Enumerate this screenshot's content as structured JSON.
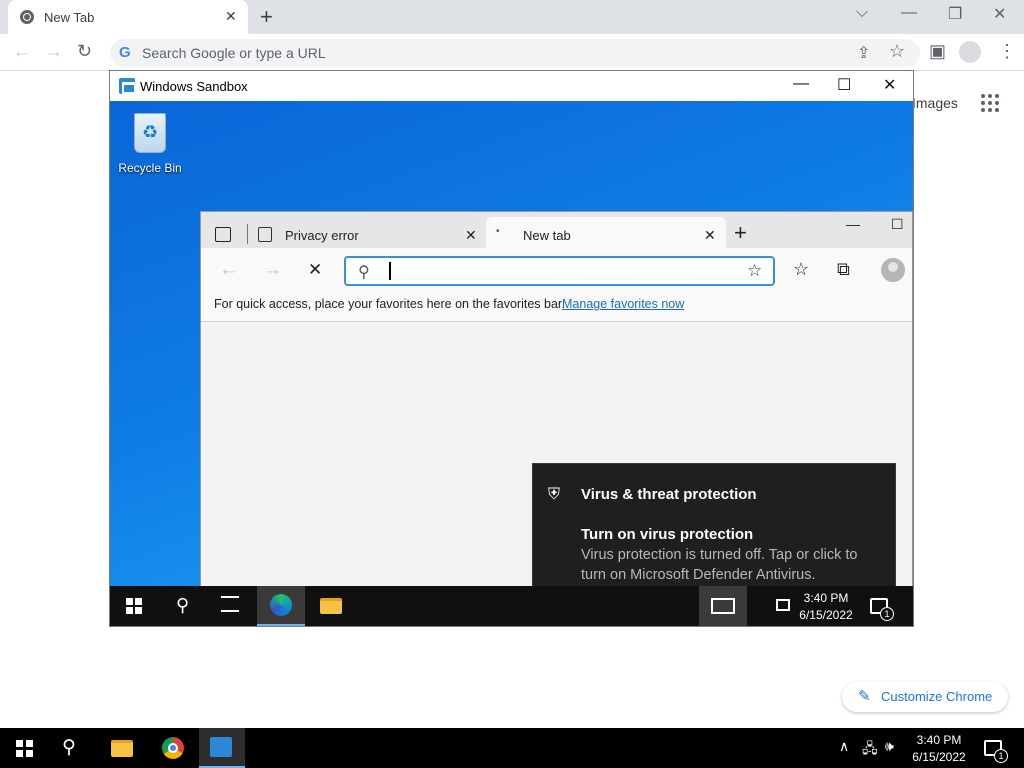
{
  "chrome": {
    "tab_title": "New Tab",
    "tab_close": "✕",
    "new_tab_glyph": "+",
    "window_controls": {
      "search_tabs": "⌵",
      "minimize": "—",
      "restore": "❐",
      "close": "✕"
    },
    "toolbar": {
      "back": "←",
      "forward": "→",
      "reload": "↻",
      "share": "⇪",
      "bookmark": "☆",
      "sidepanel": "▣",
      "menu": "⋮"
    },
    "omnibox": {
      "g_glyph": "G",
      "placeholder": "Search Google or type a URL"
    },
    "images_link": "Images",
    "customize_label": "Customize Chrome",
    "customize_glyph": "✎"
  },
  "sandbox": {
    "title": "Windows Sandbox",
    "controls": {
      "minimize": "—",
      "maximize": "☐",
      "close": "✕"
    },
    "desktop": {
      "recycle_bin_label": "Recycle Bin"
    },
    "edge": {
      "tabs": [
        {
          "title": "Privacy error",
          "close": "✕"
        },
        {
          "title": "New tab",
          "close": "✕",
          "dot": "•"
        }
      ],
      "new_tab_glyph": "+",
      "window_controls": {
        "minimize": "—",
        "maximize": "☐"
      },
      "nav": {
        "back": "←",
        "forward": "→",
        "stop": "✕"
      },
      "address": {
        "search_glyph": "⚲",
        "fav_glyph": "☆"
      },
      "right_icons": {
        "favorites": "☆",
        "collections": "⧉"
      },
      "favbar_message": "For quick access, place your favorites here on the favorites bar.",
      "favbar_link": "Manage favorites now"
    },
    "toast": {
      "shield_glyph": "⛨",
      "app_name": "Virus & threat protection",
      "title": "Turn on virus protection",
      "body": "Virus protection is turned off. Tap or click to turn on Microsoft Defender Antivirus."
    },
    "taskbar": {
      "search_glyph": "⚲",
      "time": "3:40 PM",
      "date": "6/15/2022",
      "notification_count": "1"
    }
  },
  "host_taskbar": {
    "search_glyph": "⚲",
    "tray": {
      "chevron": "∧",
      "network": "🖧",
      "volume": "🕪"
    },
    "time": "3:40 PM",
    "date": "6/15/2022",
    "notification_count": "1"
  },
  "colors": {
    "accent": "#1a73e8",
    "sandbox_blue": "#2b88d8",
    "toast_bg": "#1f1f1f"
  }
}
